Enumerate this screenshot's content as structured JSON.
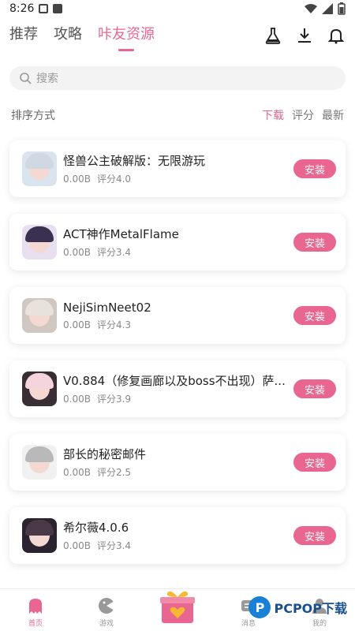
{
  "status_bar": {
    "time": "8:26"
  },
  "top_nav": {
    "tabs": [
      {
        "label": "推荐",
        "active": false
      },
      {
        "label": "攻略",
        "active": false
      },
      {
        "label": "咔友资源",
        "active": true
      }
    ],
    "icons": [
      "flask-icon",
      "download-icon",
      "bell-icon"
    ]
  },
  "search": {
    "placeholder": "搜索"
  },
  "sort": {
    "label": "排序方式",
    "options": [
      {
        "label": "下载",
        "active": true
      },
      {
        "label": "评分",
        "active": false
      },
      {
        "label": "最新",
        "active": false
      }
    ]
  },
  "items": [
    {
      "title": "怪兽公主破解版：无限游玩",
      "size": "0.00B",
      "rating": "评分4.0",
      "button": "安装",
      "thumb": {
        "bg": "#d9e4ee",
        "hair": "#cfd8e3"
      }
    },
    {
      "title": "ACT神作MetalFlame",
      "size": "0.00B",
      "rating": "评分3.4",
      "button": "安装",
      "thumb": {
        "bg": "#e8e0f0",
        "hair": "#3a3150"
      }
    },
    {
      "title": "NejiSimNeet02",
      "size": "0.00B",
      "rating": "评分4.3",
      "button": "安装",
      "thumb": {
        "bg": "#cfc7c2",
        "hair": "#e8e2dc"
      }
    },
    {
      "title": "V0.884（修复画廊以及boss不出现）萨...",
      "size": "0.00B",
      "rating": "评分3.9",
      "button": "安装",
      "thumb": {
        "bg": "#3a2e35",
        "hair": "#f4d5de"
      }
    },
    {
      "title": "部长的秘密邮件",
      "size": "0.00B",
      "rating": "评分2.5",
      "button": "安装",
      "thumb": {
        "bg": "#f1f1f1",
        "hair": "#b9b9b9"
      }
    },
    {
      "title": "希尔薇4.0.6",
      "size": "0.00B",
      "rating": "评分3.4",
      "button": "安装",
      "thumb": {
        "bg": "#2b2430",
        "hair": "#4a3a48"
      }
    }
  ],
  "bottom_nav": {
    "tabs": [
      {
        "label": "首页",
        "icon": "ghost-icon",
        "active": true
      },
      {
        "label": "游戏",
        "icon": "gamepad-icon",
        "active": false
      },
      {
        "label": "消息",
        "icon": "message-icon",
        "active": false
      },
      {
        "label": "我的",
        "icon": "profile-icon",
        "active": false
      }
    ]
  },
  "watermark": {
    "logo": "P",
    "text": "PCPOP下载"
  },
  "colors": {
    "accent": "#e8668f"
  }
}
